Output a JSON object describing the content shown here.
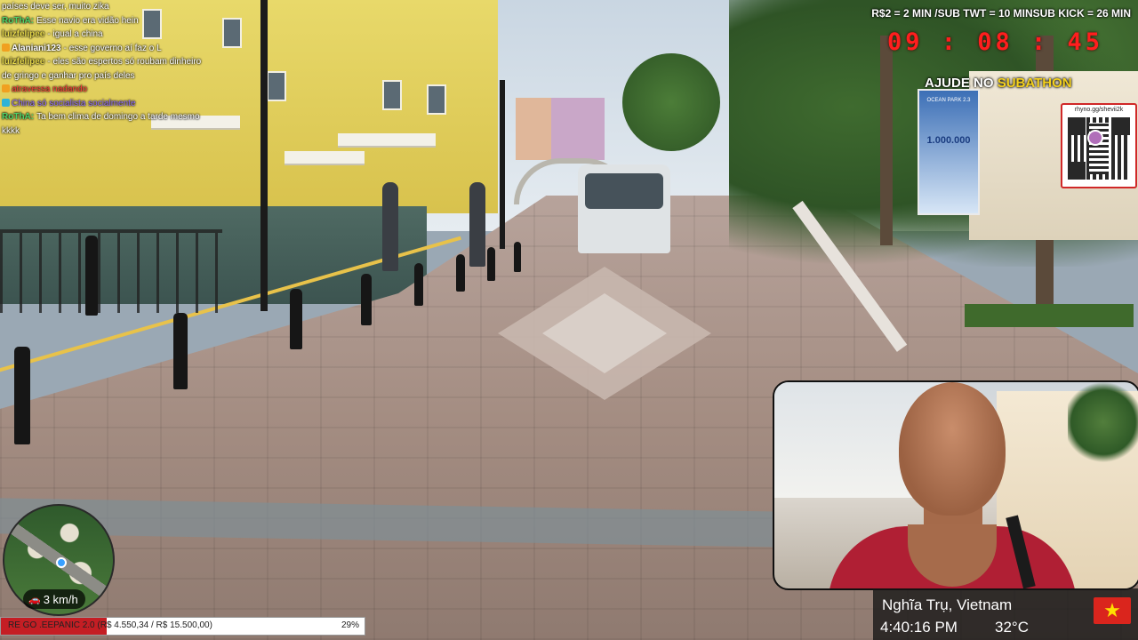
{
  "chat": [
    {
      "user": "",
      "color": "#ffffff",
      "badge": "",
      "text": "países deve ser, muito zika"
    },
    {
      "user": "RoThA:",
      "color": "#4fd46a",
      "badge": "",
      "text": "Esse navio era vidão hein"
    },
    {
      "user": "luizfelipee",
      "color": "#e6d84a",
      "badge": "",
      "text": "- igual a china"
    },
    {
      "user": "Alaniani123",
      "color": "#ffffff",
      "badge": "#f0a020",
      "text": "- esse governo aí faz o L"
    },
    {
      "user": "luizfelipee",
      "color": "#e6d84a",
      "badge": "",
      "text": "- eles são espertos só roubam dinheiro de gringo e ganhar pro país deles"
    },
    {
      "user": "",
      "color": "#ff3b3b",
      "badge": "#f0a020",
      "text": "atravessa nadando"
    },
    {
      "user": "",
      "color": "#8f6cff",
      "badge": "#2fb3d6",
      "text": "China só socialista socialmente"
    },
    {
      "user": "RoThA:",
      "color": "#4fd46a",
      "badge": "",
      "text": "Ta bem clima de domingo a tarde mesmo kkkk"
    }
  ],
  "hud": {
    "rates": "R$2 = 2 MIN /SUB TWT = 10 MINSUB KICK = 26 MIN",
    "timer": "09 : 08 : 45",
    "subathon_prefix": "AJUDE NO",
    "subathon_accent": "SUBATHON",
    "qr_url": "rhyno.gg/shevii2k"
  },
  "poster": {
    "title": "OCEAN PARK 2.3",
    "amount": "1.000.000"
  },
  "location": {
    "city": "Nghĩa Trụ, Vietnam",
    "time": "4:40:16 PM",
    "temperature": "32°C",
    "flag_star": "★"
  },
  "minimap": {
    "speed": "3 km/h"
  },
  "progress": {
    "label": "RE GO .EEPANIC 2.0 (R$ 4.550,34 / R$ 15.500,00)",
    "percent_text": "29%",
    "fraction": 0.29
  },
  "colors": {
    "timer": "#ff1e1e",
    "accent": "#f5d21e",
    "progress_fill": "#c41e24",
    "flag": "#da251d"
  },
  "icons": {
    "speed": "car-icon",
    "flag": "vietnam-flag-icon"
  }
}
